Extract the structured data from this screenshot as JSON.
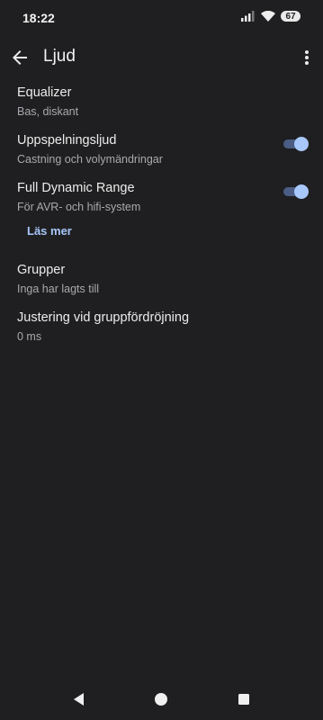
{
  "status": {
    "time": "18:22",
    "battery": "67"
  },
  "header": {
    "title": "Ljud"
  },
  "settings": [
    {
      "title": "Equalizer",
      "subtitle": "Bas, diskant"
    },
    {
      "title": "Uppspelningsljud",
      "subtitle": "Castning och volymändringar",
      "toggle": true
    },
    {
      "title": "Full Dynamic Range",
      "subtitle": "För AVR- och hifi-system",
      "toggle": true
    },
    {
      "title": "Grupper",
      "subtitle": "Inga har lagts till"
    },
    {
      "title": "Justering vid gruppfördröjning",
      "subtitle": "0 ms"
    }
  ],
  "link": {
    "label": "Läs mer"
  },
  "colors": {
    "accent": "#a8c7fa",
    "background": "#1f1f21"
  },
  "icons": [
    "signal-icon",
    "wifi-icon",
    "battery-icon",
    "back-arrow-icon",
    "more-vert-icon",
    "nav-back-icon",
    "nav-home-icon",
    "nav-recents-icon"
  ]
}
